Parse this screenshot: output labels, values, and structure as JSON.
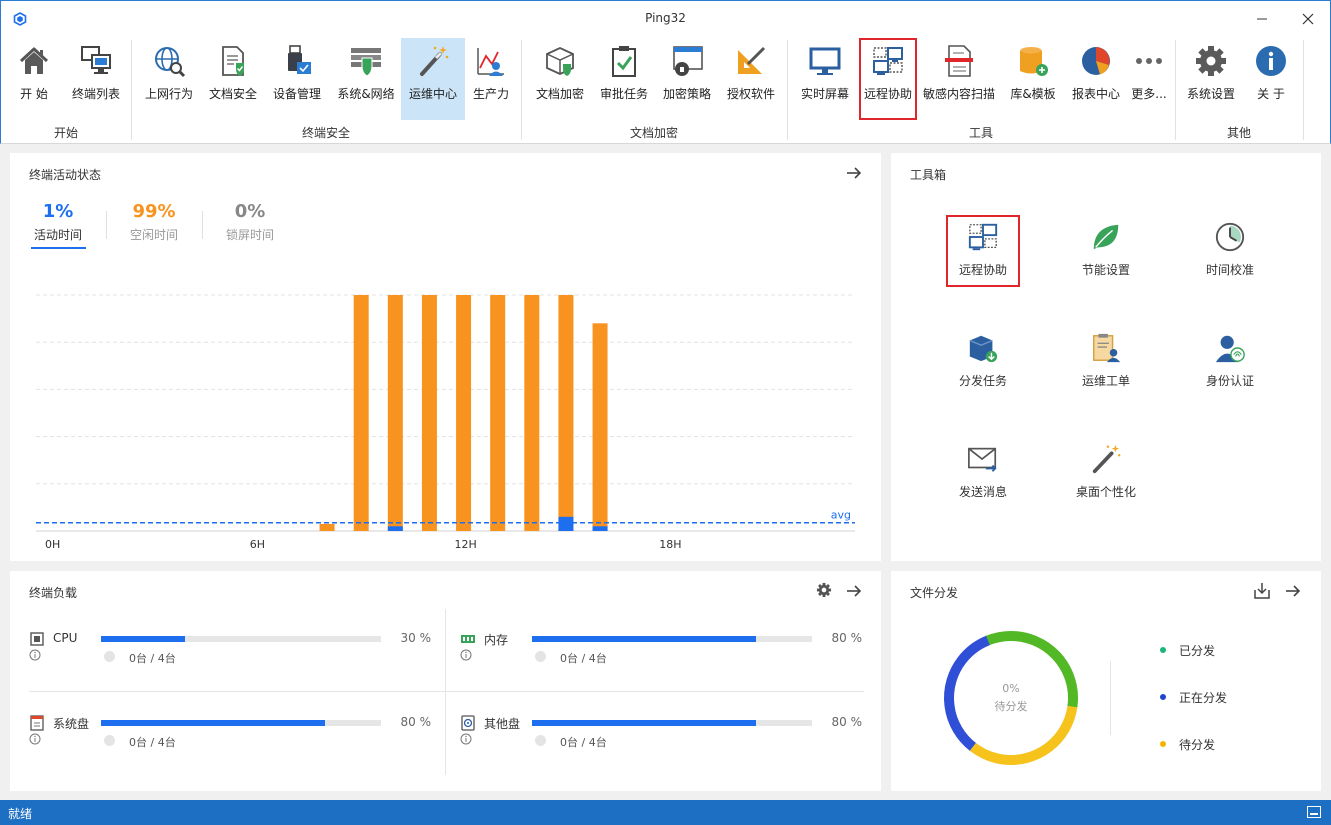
{
  "window": {
    "title": "Ping32"
  },
  "ribbon": {
    "groups": [
      {
        "label": "开始"
      },
      {
        "label": "终端安全"
      },
      {
        "label": "文档加密"
      },
      {
        "label": "工具"
      },
      {
        "label": "其他"
      }
    ],
    "buttons": [
      {
        "label": "开 始",
        "icon": "home-icon"
      },
      {
        "label": "终端列表",
        "icon": "terminal-list-icon"
      },
      {
        "label": "上网行为",
        "icon": "web-behavior-icon"
      },
      {
        "label": "文档安全",
        "icon": "document-security-icon"
      },
      {
        "label": "设备管理",
        "icon": "device-management-icon"
      },
      {
        "label": "系统&网络",
        "icon": "system-network-icon"
      },
      {
        "label": "运维中心",
        "icon": "ops-center-icon"
      },
      {
        "label": "生产力",
        "icon": "productivity-icon"
      },
      {
        "label": "文档加密",
        "icon": "document-encryption-icon"
      },
      {
        "label": "审批任务",
        "icon": "approval-task-icon"
      },
      {
        "label": "加密策略",
        "icon": "encryption-policy-icon"
      },
      {
        "label": "授权软件",
        "icon": "licensed-software-icon"
      },
      {
        "label": "实时屏幕",
        "icon": "live-screen-icon"
      },
      {
        "label": "远程协助",
        "icon": "remote-assist-icon"
      },
      {
        "label": "敏感内容扫描",
        "icon": "sensitive-scan-icon"
      },
      {
        "label": "库&模板",
        "icon": "library-template-icon"
      },
      {
        "label": "报表中心",
        "icon": "report-center-icon"
      },
      {
        "label": "更多...",
        "icon": "more-icon"
      },
      {
        "label": "系统设置",
        "icon": "settings-gear-icon"
      },
      {
        "label": "关 于",
        "icon": "about-info-icon"
      }
    ]
  },
  "activity": {
    "title": "终端活动状态",
    "stats": [
      {
        "value": "1%",
        "caption": "活动时间",
        "color": "#1e6ff0"
      },
      {
        "value": "99%",
        "caption": "空闲时间",
        "color": "#f7931e"
      },
      {
        "value": "0%",
        "caption": "锁屏时间",
        "color": "#888888"
      }
    ],
    "avg_label": "avg"
  },
  "chart_data": {
    "type": "bar",
    "x_ticks": [
      "0H",
      "6H",
      "12H",
      "18H"
    ],
    "hours": [
      8,
      9,
      10,
      11,
      12,
      13,
      14,
      15,
      16
    ],
    "series": [
      {
        "name": "空闲时间",
        "color": "#f7931e",
        "values": [
          3,
          100,
          100,
          100,
          100,
          100,
          100,
          100,
          88
        ]
      },
      {
        "name": "活动时间",
        "color": "#1e6ff0",
        "values": [
          0,
          0,
          2,
          0,
          0,
          0,
          0,
          6,
          2
        ]
      }
    ],
    "avg_value": 3.5,
    "ylim": [
      0,
      100
    ],
    "grid": true
  },
  "toolbox": {
    "title": "工具箱",
    "items": [
      {
        "label": "远程协助",
        "icon": "remote-assist-icon"
      },
      {
        "label": "节能设置",
        "icon": "leaf-icon"
      },
      {
        "label": "时间校准",
        "icon": "clock-icon"
      },
      {
        "label": "分发任务",
        "icon": "distribute-box-icon"
      },
      {
        "label": "运维工单",
        "icon": "ops-ticket-icon"
      },
      {
        "label": "身份认证",
        "icon": "identity-fingerprint-icon"
      },
      {
        "label": "发送消息",
        "icon": "send-message-icon"
      },
      {
        "label": "桌面个性化",
        "icon": "magic-wand-icon"
      }
    ]
  },
  "load": {
    "title": "终端负载",
    "items": [
      {
        "name": "CPU",
        "percent": 30,
        "percent_label": "30 %",
        "count": "0台 / 4台",
        "icon": "cpu-icon"
      },
      {
        "name": "内存",
        "percent": 80,
        "percent_label": "80 %",
        "count": "0台 / 4台",
        "icon": "memory-icon"
      },
      {
        "name": "系统盘",
        "percent": 80,
        "percent_label": "80 %",
        "count": "0台 / 4台",
        "icon": "system-disk-icon"
      },
      {
        "name": "其他盘",
        "percent": 80,
        "percent_label": "80 %",
        "count": "0台 / 4台",
        "icon": "other-disk-icon"
      }
    ]
  },
  "distribution": {
    "title": "文件分发",
    "center_value": "0%",
    "center_caption": "待分发",
    "legend": [
      {
        "label": "已分发",
        "color": "#1db37a"
      },
      {
        "label": "正在分发",
        "color": "#2244cc"
      },
      {
        "label": "待分发",
        "color": "#f5b400"
      }
    ],
    "ring_colors": {
      "green": "#52b826",
      "yellow": "#f5c31c",
      "blue": "#2e4fd6"
    }
  },
  "statusbar": {
    "text": "就绪"
  }
}
